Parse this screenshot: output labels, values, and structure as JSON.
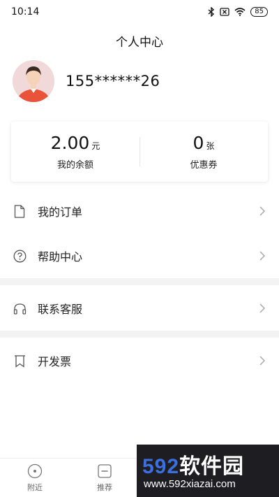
{
  "status": {
    "time": "10:14",
    "battery": "85"
  },
  "header": {
    "title": "个人中心"
  },
  "profile": {
    "phone": "155******26"
  },
  "stats": {
    "balance_value": "2.00",
    "balance_unit": "元",
    "balance_label": "我的余额",
    "coupon_value": "0",
    "coupon_unit": "张",
    "coupon_label": "优惠券"
  },
  "menu": [
    {
      "label": "我的订单",
      "icon": "document-icon"
    },
    {
      "label": "帮助中心",
      "icon": "help-circle-icon"
    },
    {
      "label": "联系客服",
      "icon": "headphones-icon"
    },
    {
      "label": "开发票",
      "icon": "bookmark-icon"
    }
  ],
  "tabs": [
    {
      "label": "附近",
      "icon": "nearby-icon"
    },
    {
      "label": "推荐",
      "icon": "recommend-icon"
    }
  ],
  "watermark": {
    "brand_num": "592",
    "brand_cn": "软件园",
    "url": "www.592xiazai.com"
  },
  "colors": {
    "avatar_shirt": "#e8533a",
    "watermark_blue": "#3b6fe0"
  }
}
